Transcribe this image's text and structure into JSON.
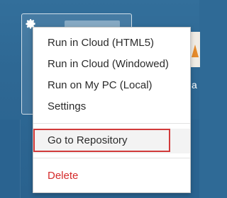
{
  "menu": {
    "items": [
      {
        "label": "Run in Cloud (HTML5)"
      },
      {
        "label": "Run in Cloud (Windowed)"
      },
      {
        "label": "Run on My PC (Local)"
      },
      {
        "label": "Settings"
      },
      {
        "label": "Go to Repository"
      },
      {
        "label": "Delete"
      }
    ]
  },
  "background": {
    "right_text": "a"
  },
  "colors": {
    "background": "#2f6a96",
    "menu_bg": "#ffffff",
    "delete": "#d52b2b",
    "highlight_border": "#d13a3a"
  },
  "icons": {
    "tile_icon": "gear-icon"
  }
}
